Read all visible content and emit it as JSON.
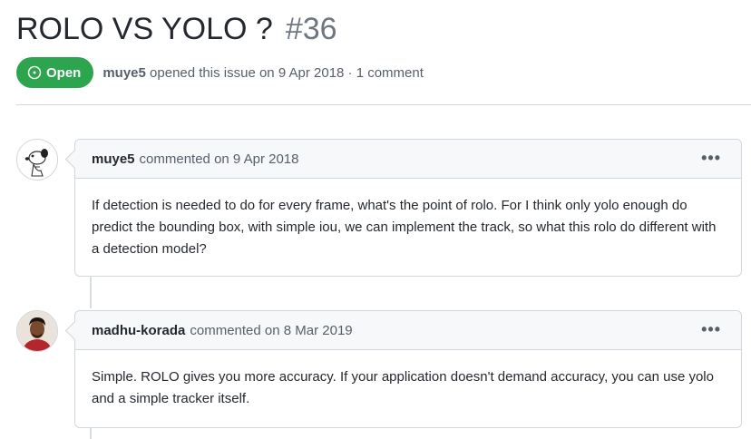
{
  "issue": {
    "title": "ROLO VS YOLO ?",
    "number": "#36",
    "state": "Open",
    "author": "muye5",
    "meta_rest": "opened this issue on 9 Apr 2018 · 1 comment"
  },
  "comments": [
    {
      "author": "muye5",
      "action": "commented on 9 Apr 2018",
      "menu": "•••",
      "body": "If detection is needed to do for every frame, what's the point of rolo. For I think only yolo enough do predict the bounding box, with simple iou, we can implement the track, so what this rolo do different with a detection model?"
    },
    {
      "author": "madhu-korada",
      "action": "commented on 8 Mar 2019",
      "menu": "•••",
      "body": "Simple. ROLO gives you more accuracy. If your application doesn't demand accuracy, you can use yolo and a simple tracker itself."
    }
  ],
  "colors": {
    "open_badge": "#2da44e",
    "border": "#d0d7de",
    "header_bg": "#f6f8fa"
  }
}
